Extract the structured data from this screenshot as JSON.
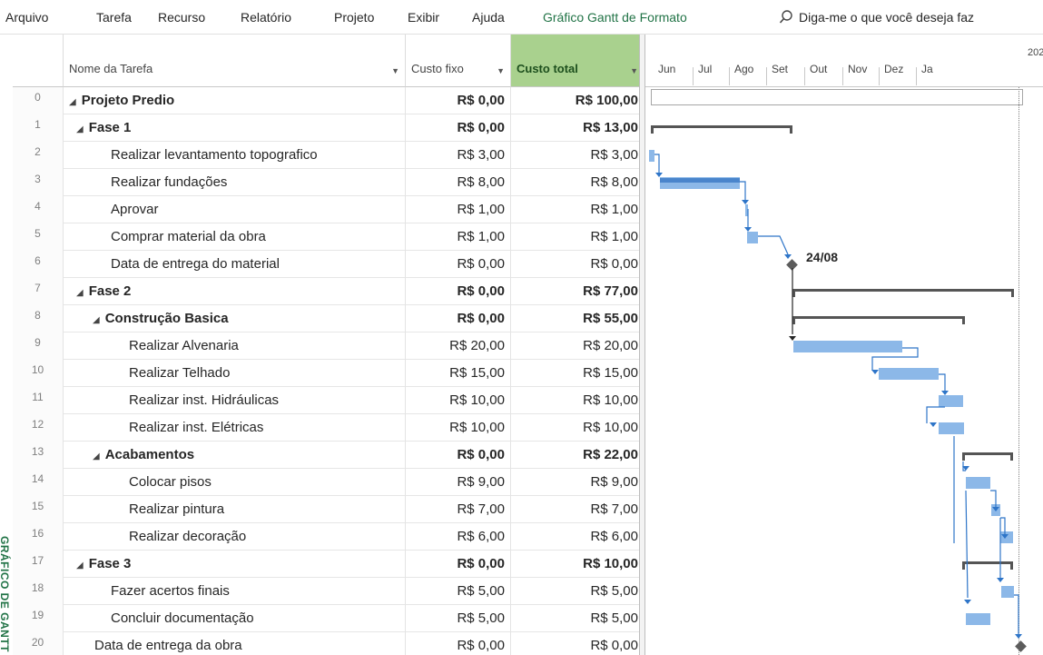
{
  "ribbon": {
    "tabs": [
      "Arquivo",
      "Tarefa",
      "Recurso",
      "Relatório",
      "Projeto",
      "Exibir",
      "Ajuda"
    ],
    "format_tab": "Gráfico Gantt de Formato",
    "search_text": "Diga-me o que você deseja faz"
  },
  "view_label": "GRÁFICO DE GANTT",
  "table": {
    "headers": {
      "name": "Nome da Tarefa",
      "fixed_cost": "Custo fixo",
      "total_cost": "Custo total"
    },
    "rows": [
      {
        "id": "0",
        "name": "Projeto Predio",
        "fixed": "R$ 0,00",
        "total": "R$ 100,00",
        "level": 0,
        "summary": true,
        "project": true
      },
      {
        "id": "1",
        "name": "Fase 1",
        "fixed": "R$ 0,00",
        "total": "R$ 13,00",
        "level": 1,
        "summary": true
      },
      {
        "id": "2",
        "name": "Realizar levantamento topografico",
        "fixed": "R$ 3,00",
        "total": "R$ 3,00",
        "level": 2
      },
      {
        "id": "3",
        "name": "Realizar fundações",
        "fixed": "R$ 8,00",
        "total": "R$ 8,00",
        "level": 2
      },
      {
        "id": "4",
        "name": "Aprovar",
        "fixed": "R$ 1,00",
        "total": "R$ 1,00",
        "level": 2
      },
      {
        "id": "5",
        "name": "Comprar material da obra",
        "fixed": "R$ 1,00",
        "total": "R$ 1,00",
        "level": 2
      },
      {
        "id": "6",
        "name": "Data de entrega do material",
        "fixed": "R$ 0,00",
        "total": "R$ 0,00",
        "level": 2
      },
      {
        "id": "7",
        "name": "Fase 2",
        "fixed": "R$ 0,00",
        "total": "R$ 77,00",
        "level": 1,
        "summary": true
      },
      {
        "id": "8",
        "name": "Construção Basica",
        "fixed": "R$ 0,00",
        "total": "R$ 55,00",
        "level": 2,
        "summary": true
      },
      {
        "id": "9",
        "name": "Realizar Alvenaria",
        "fixed": "R$ 20,00",
        "total": "R$ 20,00",
        "level": 3
      },
      {
        "id": "10",
        "name": "Realizar Telhado",
        "fixed": "R$ 15,00",
        "total": "R$ 15,00",
        "level": 3
      },
      {
        "id": "11",
        "name": "Realizar inst. Hidráulicas",
        "fixed": "R$ 10,00",
        "total": "R$ 10,00",
        "level": 3
      },
      {
        "id": "12",
        "name": "Realizar inst. Elétricas",
        "fixed": "R$ 10,00",
        "total": "R$ 10,00",
        "level": 3
      },
      {
        "id": "13",
        "name": "Acabamentos",
        "fixed": "R$ 0,00",
        "total": "R$ 22,00",
        "level": 2,
        "summary": true
      },
      {
        "id": "14",
        "name": "Colocar pisos",
        "fixed": "R$ 9,00",
        "total": "R$ 9,00",
        "level": 3
      },
      {
        "id": "15",
        "name": "Realizar pintura",
        "fixed": "R$ 7,00",
        "total": "R$ 7,00",
        "level": 3
      },
      {
        "id": "16",
        "name": "Realizar decoração",
        "fixed": "R$ 6,00",
        "total": "R$ 6,00",
        "level": 3
      },
      {
        "id": "17",
        "name": "Fase 3",
        "fixed": "R$ 0,00",
        "total": "R$ 10,00",
        "level": 1,
        "summary": true
      },
      {
        "id": "18",
        "name": "Fazer acertos finais",
        "fixed": "R$ 5,00",
        "total": "R$ 5,00",
        "level": 2
      },
      {
        "id": "19",
        "name": "Concluir documentação",
        "fixed": "R$ 5,00",
        "total": "R$ 5,00",
        "level": 2
      },
      {
        "id": "20",
        "name": "Data de entrega da obra",
        "fixed": "R$ 0,00",
        "total": "R$ 0,00",
        "level": 1
      }
    ]
  },
  "timeline": {
    "year_label": "202",
    "months": [
      "Jun",
      "Jul",
      "Ago",
      "Set",
      "Out",
      "Nov",
      "Dez",
      "Ja"
    ]
  },
  "gantt": {
    "milestone_label": "24/08",
    "colors": {
      "task_bar": "#8cb8e8",
      "critical_bar": "#4a85cc",
      "summary_bar": "#555555",
      "link": "#2e75c8"
    }
  }
}
